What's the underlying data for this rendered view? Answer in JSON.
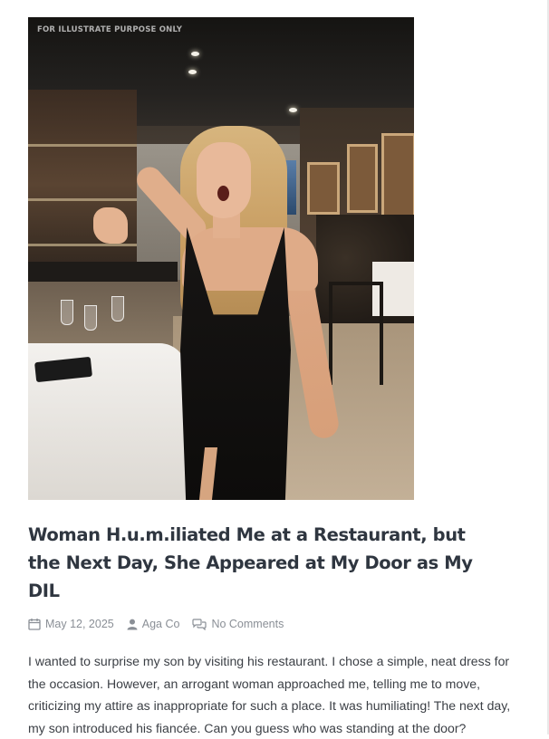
{
  "featured_image": {
    "watermark": "FOR ILLUSTRATE PURPOSE ONLY"
  },
  "post": {
    "title": "Woman H.u.m.iliated Me at a Restaurant, but the Next Day, She Appeared at My Door as My DIL",
    "date": "May 12, 2025",
    "author": "Aga Co",
    "comments": "No Comments",
    "excerpt": "I wanted to surprise my son by visiting his restaurant. I chose a simple, neat dress for the occasion. However, an arrogant woman approached me, telling me to move, criticizing my attire as inappropriate for such a place. It was humiliating! The next day, my son introduced his fiancée. Can you guess who was standing at the door?"
  },
  "icons": {
    "date": "calendar-icon",
    "author": "user-icon",
    "comments": "comments-icon"
  },
  "colors": {
    "title": "#2f3640",
    "meta": "#8a8f96",
    "body_text": "#3b3f45"
  }
}
